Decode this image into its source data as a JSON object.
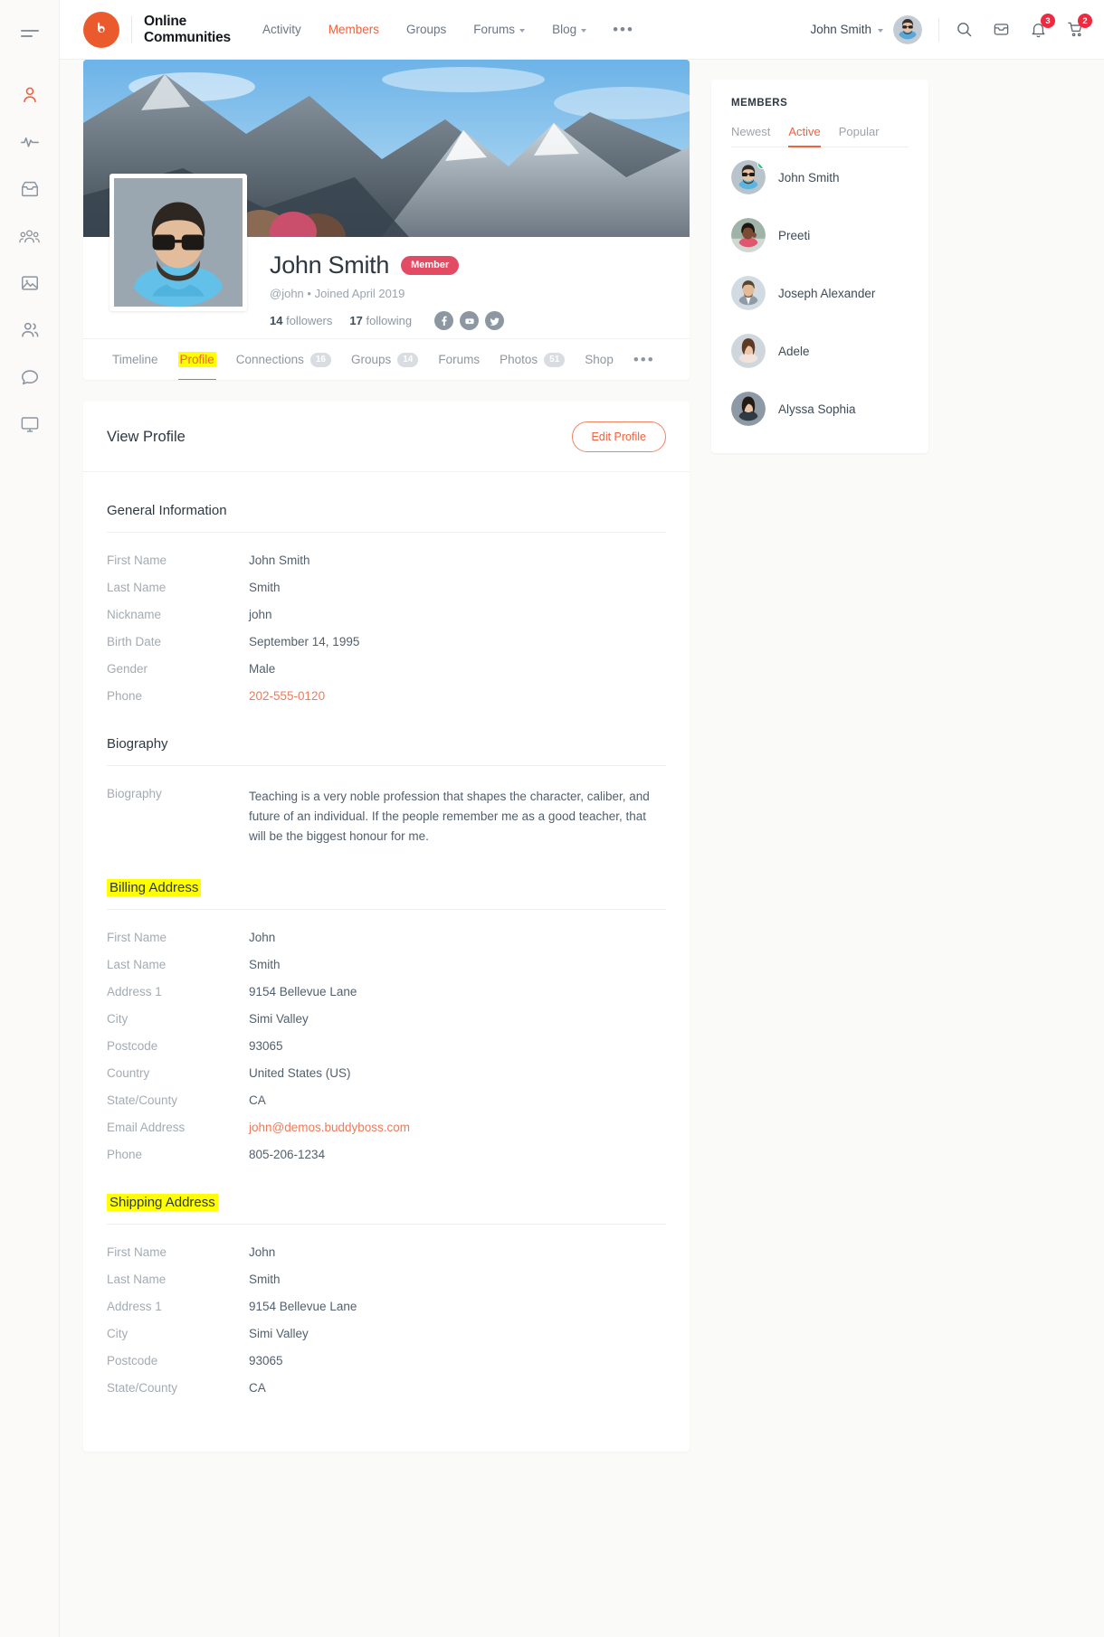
{
  "header": {
    "brand_line1": "Online",
    "brand_line2": "Communities",
    "logo_icon": "buddyboss-logo-icon",
    "menu_icon": "hamburger-icon",
    "nav": [
      {
        "label": "Activity",
        "icon": "",
        "has_caret": false,
        "active": false
      },
      {
        "label": "Members",
        "icon": "",
        "has_caret": false,
        "active": true
      },
      {
        "label": "Groups",
        "icon": "",
        "has_caret": false,
        "active": false
      },
      {
        "label": "Forums",
        "icon": "chevron-down-icon",
        "has_caret": true,
        "active": false
      },
      {
        "label": "Blog",
        "icon": "chevron-down-icon",
        "has_caret": true,
        "active": false
      }
    ],
    "nav_more_label": "•••",
    "user_name": "John Smith",
    "user_caret_icon": "chevron-down-icon",
    "avatar_icon": "user-avatar",
    "icons": [
      {
        "name": "search-icon",
        "badge": ""
      },
      {
        "name": "inbox-icon",
        "badge": ""
      },
      {
        "name": "notifications-bell-icon",
        "badge": "3"
      },
      {
        "name": "shopping-cart-icon",
        "badge": "2"
      }
    ]
  },
  "sidebar_rail": {
    "items": [
      {
        "icon": "profile-person-icon",
        "active": true
      },
      {
        "icon": "activity-pulse-icon",
        "active": false
      },
      {
        "icon": "inbox-messages-icon",
        "active": false
      },
      {
        "icon": "groups-icon",
        "active": false
      },
      {
        "icon": "photos-image-icon",
        "active": false
      },
      {
        "icon": "connections-people-icon",
        "active": false
      },
      {
        "icon": "forums-chat-icon",
        "active": false
      },
      {
        "icon": "courses-monitor-icon",
        "active": false
      }
    ]
  },
  "profile": {
    "name": "John Smith",
    "badge": "Member",
    "handle": "@john",
    "meta_separator": "•",
    "joined": "Joined April 2019",
    "followers_count": "14",
    "followers_label": "followers",
    "following_count": "17",
    "following_label": "following",
    "socials": [
      {
        "name": "facebook-icon"
      },
      {
        "name": "youtube-icon"
      },
      {
        "name": "twitter-icon"
      }
    ],
    "tabs": [
      {
        "label": "Timeline",
        "count": "",
        "active": false,
        "highlighted": false
      },
      {
        "label": "Profile",
        "count": "",
        "active": true,
        "highlighted": true
      },
      {
        "label": "Connections",
        "count": "16",
        "active": false,
        "highlighted": false
      },
      {
        "label": "Groups",
        "count": "14",
        "active": false,
        "highlighted": false
      },
      {
        "label": "Forums",
        "count": "",
        "active": false,
        "highlighted": false
      },
      {
        "label": "Photos",
        "count": "51",
        "active": false,
        "highlighted": false
      },
      {
        "label": "Shop",
        "count": "",
        "active": false,
        "highlighted": false
      }
    ],
    "tabs_more_label": "•••"
  },
  "view_profile": {
    "title": "View Profile",
    "edit_button": "Edit Profile",
    "sections": [
      {
        "title": "General Information",
        "highlighted": false,
        "fields": [
          {
            "label": "First Name",
            "value": "John Smith",
            "link": false
          },
          {
            "label": "Last Name",
            "value": "Smith",
            "link": false
          },
          {
            "label": "Nickname",
            "value": "john",
            "link": false
          },
          {
            "label": "Birth Date",
            "value": "September 14, 1995",
            "link": false
          },
          {
            "label": "Gender",
            "value": "Male",
            "link": false
          },
          {
            "label": "Phone",
            "value": "202-555-0120",
            "link": true
          }
        ]
      },
      {
        "title": "Biography",
        "highlighted": false,
        "fields": [
          {
            "label": "Biography",
            "value": "Teaching is a very noble profession that shapes the character, caliber, and future of an individual. If the people remember me as a good teacher, that will be the biggest honour for me.",
            "link": false,
            "bio": true
          }
        ]
      },
      {
        "title": "Billing Address",
        "highlighted": true,
        "fields": [
          {
            "label": "First Name",
            "value": "John",
            "link": false
          },
          {
            "label": "Last Name",
            "value": "Smith",
            "link": false
          },
          {
            "label": "Address 1",
            "value": "9154 Bellevue Lane",
            "link": false
          },
          {
            "label": "City",
            "value": "Simi Valley",
            "link": false
          },
          {
            "label": "Postcode",
            "value": "93065",
            "link": false
          },
          {
            "label": "Country",
            "value": "United States (US)",
            "link": false
          },
          {
            "label": "State/County",
            "value": "CA",
            "link": false
          },
          {
            "label": "Email Address",
            "value": "john@demos.buddyboss.com",
            "link": true
          },
          {
            "label": "Phone",
            "value": "805-206-1234",
            "link": false
          }
        ]
      },
      {
        "title": "Shipping Address",
        "highlighted": true,
        "fields": [
          {
            "label": "First Name",
            "value": "John",
            "link": false
          },
          {
            "label": "Last Name",
            "value": "Smith",
            "link": false
          },
          {
            "label": "Address 1",
            "value": "9154 Bellevue Lane",
            "link": false
          },
          {
            "label": "City",
            "value": "Simi Valley",
            "link": false
          },
          {
            "label": "Postcode",
            "value": "93065",
            "link": false
          },
          {
            "label": "State/County",
            "value": "CA",
            "link": false
          }
        ]
      }
    ]
  },
  "members_widget": {
    "title": "MEMBERS",
    "tabs": [
      {
        "label": "Newest",
        "active": false
      },
      {
        "label": "Active",
        "active": true
      },
      {
        "label": "Popular",
        "active": false
      }
    ],
    "members": [
      {
        "name": "John Smith",
        "online": true,
        "avatar": "avatar-john"
      },
      {
        "name": "Preeti",
        "online": false,
        "avatar": "avatar-preeti"
      },
      {
        "name": "Joseph Alexander",
        "online": false,
        "avatar": "avatar-joseph"
      },
      {
        "name": "Adele",
        "online": false,
        "avatar": "avatar-adele"
      },
      {
        "name": "Alyssa Sophia",
        "online": false,
        "avatar": "avatar-alyssa"
      }
    ]
  },
  "colors": {
    "accent": "#f1613d",
    "badge_red": "#ed2a3f",
    "member_badge": "#e24b63",
    "highlight": "#ffff00",
    "online_green": "#1dc87d",
    "logo_orange": "#ea5a2d"
  }
}
